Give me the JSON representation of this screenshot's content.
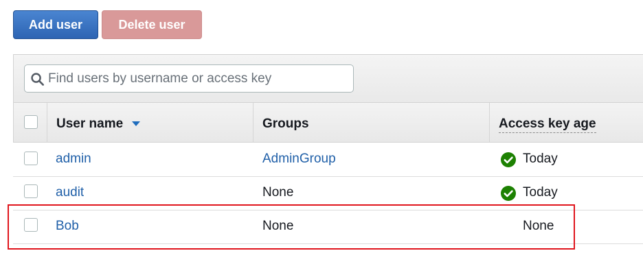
{
  "toolbar": {
    "add_user_label": "Add user",
    "delete_user_label": "Delete user"
  },
  "search": {
    "placeholder": "Find users by username or access key",
    "value": ""
  },
  "table": {
    "columns": {
      "username": "User name",
      "groups": "Groups",
      "access_key_age": "Access key age"
    },
    "sort": {
      "column": "username",
      "direction": "desc"
    },
    "rows": [
      {
        "username": "admin",
        "groups": "AdminGroup",
        "groups_is_link": true,
        "access_key_age": "Today",
        "has_check_icon": true
      },
      {
        "username": "audit",
        "groups": "None",
        "groups_is_link": false,
        "access_key_age": "Today",
        "has_check_icon": true
      },
      {
        "username": "Bob",
        "groups": "None",
        "groups_is_link": false,
        "access_key_age": "None",
        "has_check_icon": false
      }
    ]
  },
  "colors": {
    "primary_button": "#2d64b3",
    "disabled_danger_button": "#d99999",
    "link": "#1f5fa8",
    "success_check": "#1d8102",
    "highlight_border": "#e0141c"
  },
  "icons": {
    "search": "search-icon",
    "sort": "sort-desc-icon",
    "status": "check-circle-icon"
  }
}
